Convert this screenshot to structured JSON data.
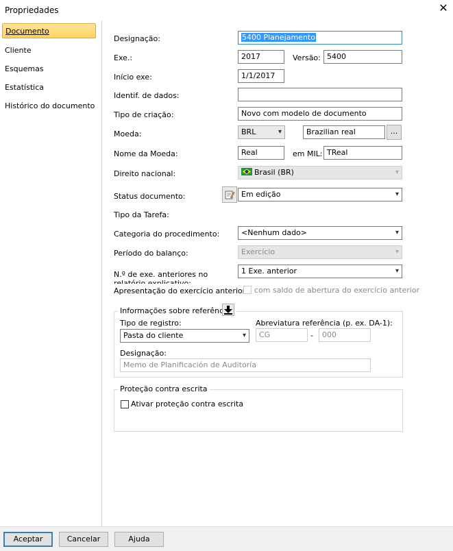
{
  "window": {
    "title": "Propriedades",
    "close_icon": "close-icon"
  },
  "sidebar": {
    "items": [
      {
        "label": "Documento",
        "active": true
      },
      {
        "label": "Cliente"
      },
      {
        "label": "Esquemas"
      },
      {
        "label": "Estatística"
      },
      {
        "label": "Histórico do documento"
      }
    ]
  },
  "form": {
    "designacao_label": "Designação:",
    "designacao_value": "5400 Planejamento",
    "exe_label": "Exe.:",
    "exe_value": "2017",
    "versao_label": "Versão:",
    "versao_value": "5400",
    "inicio_label": "Início exe:",
    "inicio_value": "1/1/2017",
    "identif_label": "Identif. de dados:",
    "identif_value": "",
    "tipo_criacao_label": "Tipo de criação:",
    "tipo_criacao_value": "Novo com modelo de documento",
    "moeda_label": "Moeda:",
    "moeda_value": "BRL",
    "moeda_name_value": "Brazilian real",
    "ellipsis_label": "...",
    "nome_moeda_label": "Nome da Moeda:",
    "nome_moeda_value": "Real",
    "em_mil_label": "em MIL:",
    "em_mil_value": "TReal",
    "direito_label": "Direito nacional:",
    "direito_value": "Brasil (BR)",
    "status_label": "Status documento:",
    "status_value": "Em edição",
    "tipo_tarefa_label": "Tipo da Tarefa:",
    "categoria_label": "Categoria do procedimento:",
    "categoria_value": "<Nenhum dado>",
    "periodo_label": "Período do balanço:",
    "periodo_value": "Exercício",
    "num_exe_label": "N.º de exe. anteriores no relatório explicativo:",
    "num_exe_value": "1 Exe. anterior",
    "apresentacao_label": "Apresentação do exercício anterior:",
    "apresentacao_check_label": "com saldo de abertura do exercício anterior"
  },
  "referencias": {
    "title": "Informações sobre referências",
    "tipo_registro_label": "Tipo de registro:",
    "tipo_registro_value": "Pasta do cliente",
    "abreviatura_label": "Abreviatura referência (p. ex. DA-1):",
    "abrev_prefix": "CG",
    "abrev_sep": "-",
    "abrev_suffix": "000",
    "designacao_label": "Designação:",
    "designacao_value": "Memo de Planificación de Auditoría"
  },
  "protecao": {
    "title": "Proteção contra escrita",
    "check_label": "Ativar proteção contra escrita",
    "checked": false
  },
  "footer": {
    "accept": "Aceptar",
    "cancel": "Cancelar",
    "help": "Ajuda"
  },
  "colors": {
    "accent": "#3c7fb1",
    "selection": "#3399ff",
    "sidebar_active": "#ffd25e"
  }
}
